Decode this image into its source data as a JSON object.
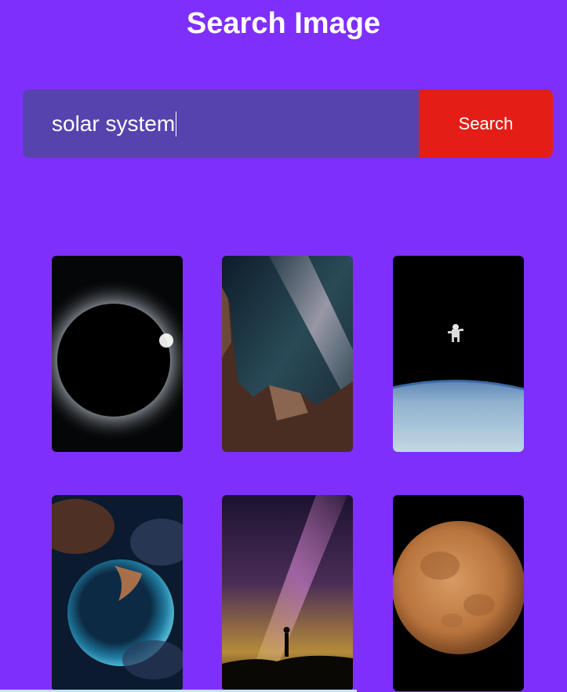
{
  "header": {
    "title": "Search Image"
  },
  "search": {
    "query": "solar system",
    "button_label": "Search",
    "button_color": "#e41d16",
    "input_color": "#5743ae"
  },
  "theme": {
    "background": "#7f2ffb"
  },
  "results": [
    {
      "icon": "solar-eclipse-image"
    },
    {
      "icon": "milky-way-canyon-image"
    },
    {
      "icon": "astronaut-over-earth-image"
    },
    {
      "icon": "bubble-nebula-image"
    },
    {
      "icon": "starry-sky-silhouette-image"
    },
    {
      "icon": "orange-moon-image"
    }
  ]
}
